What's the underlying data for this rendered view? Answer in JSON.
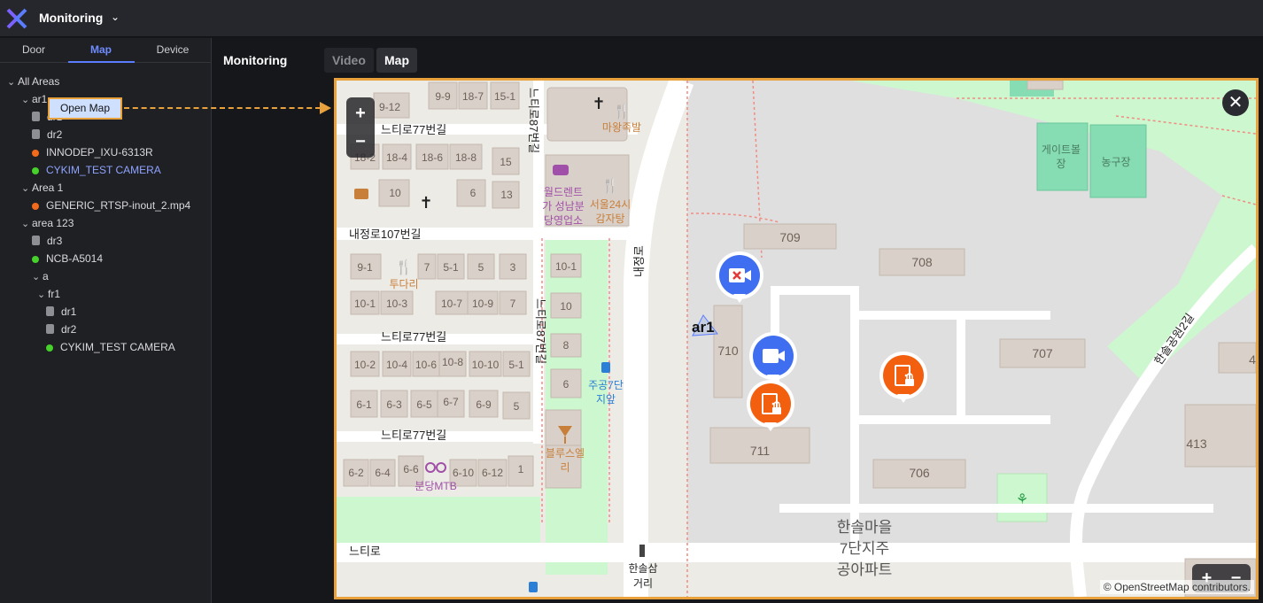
{
  "header": {
    "app_title": "Monitoring"
  },
  "sidebar": {
    "tabs": [
      "Door",
      "Map",
      "Device"
    ],
    "active_tab": "Map",
    "tree": [
      {
        "label": "All Areas"
      },
      {
        "label": "ar1"
      },
      {
        "label": "dr1"
      },
      {
        "label": "dr2"
      },
      {
        "label": "INNODEP_IXU-6313R"
      },
      {
        "label": "CYKIM_TEST CAMERA"
      },
      {
        "label": "Area 1"
      },
      {
        "label": "GENERIC_RTSP-inout_2.mp4"
      },
      {
        "label": "area 123"
      },
      {
        "label": "dr3"
      },
      {
        "label": "NCB-A5014"
      },
      {
        "label": "a"
      },
      {
        "label": "fr1"
      },
      {
        "label": "dr1"
      },
      {
        "label": "dr2"
      },
      {
        "label": "CYKIM_TEST CAMERA"
      }
    ],
    "context_button": "Open Map"
  },
  "content": {
    "title": "Monitoring",
    "view_tabs": [
      "Video",
      "Map"
    ],
    "active_view": "Map"
  },
  "map": {
    "zoom_in": "+",
    "zoom_out": "−",
    "close": "✕",
    "area_label": "ar1",
    "attribution": "© OpenStreetMap contributors.",
    "street_labels": [
      "느티로77번길",
      "느티로77번길",
      "느티로77번길",
      "내정로107번길",
      "느티로",
      "내정로",
      "느티로87번길",
      "느티로87번길",
      "한솔공원2길"
    ],
    "building_numbers": [
      "9-9",
      "18-7",
      "15-1",
      "9-12",
      "18-2",
      "18-4",
      "18-6",
      "18-8",
      "15",
      "10",
      "6",
      "13",
      "9-1",
      "7",
      "5-1",
      "5",
      "3",
      "10-1",
      "10-3",
      "10-7",
      "10-9",
      "7",
      "10-1",
      "10",
      "8",
      "6",
      "10-2",
      "10-4",
      "10-6",
      "10-8",
      "10-10",
      "5-1",
      "6-1",
      "6-3",
      "6-5",
      "6-7",
      "6-9",
      "5",
      "6-2",
      "6-4",
      "6-6",
      "6-10",
      "6-12",
      "1",
      "709",
      "708",
      "710",
      "707",
      "711",
      "706",
      "413",
      "4"
    ],
    "poi_labels": [
      "마왕족발",
      "월드렌트가 성남분당영업소",
      "서울24시감자탕",
      "투다리",
      "주공7단지앞",
      "블루스엘리",
      "분당MTB",
      "한솔삼거리",
      "게이트볼장",
      "농구장",
      "한솔마을7단지주공아파트"
    ],
    "markers": [
      {
        "type": "camera-error",
        "icon": "camera-off-icon"
      },
      {
        "type": "camera",
        "icon": "camera-icon"
      },
      {
        "type": "door-locked",
        "icon": "door-lock-icon"
      },
      {
        "type": "door-locked",
        "icon": "door-lock-icon"
      }
    ]
  },
  "colors": {
    "accent": "#5b7cff",
    "highlight": "#e9a23b",
    "status_error": "#f26a1b",
    "status_ok": "#46d12b",
    "camera_marker": "#3f6ef0",
    "door_marker": "#f2600f"
  }
}
